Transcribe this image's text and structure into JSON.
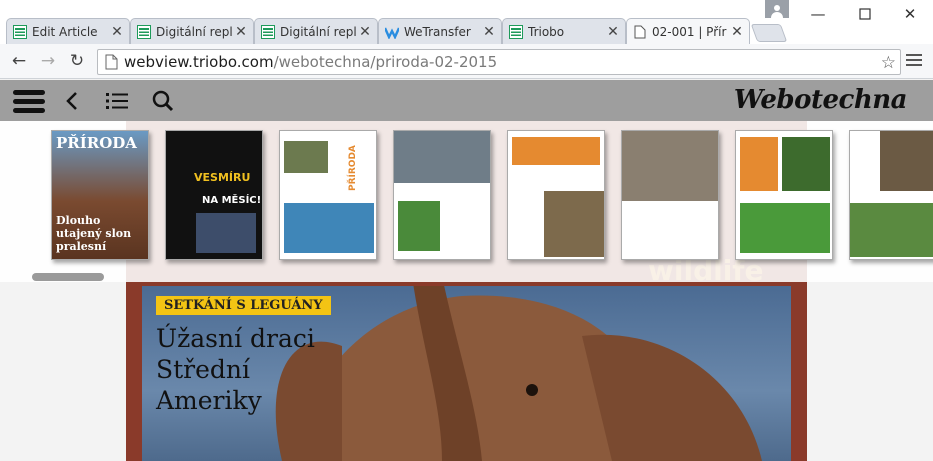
{
  "tabs": [
    {
      "title": "Edit Article",
      "icon": "sheet-icon",
      "active": false
    },
    {
      "title": "Digitální repl",
      "icon": "sheet-icon",
      "active": false
    },
    {
      "title": "Digitální repl",
      "icon": "sheet-icon",
      "active": false
    },
    {
      "title": "WeTransfer",
      "icon": "wetransfer-icon",
      "active": false
    },
    {
      "title": "Triobo",
      "icon": "sheet-icon",
      "active": false
    },
    {
      "title": "02-001 | Přír",
      "icon": "page-icon",
      "active": true
    }
  ],
  "address": {
    "host": "webview.triobo.com",
    "path": "/webotechna/priroda-02-2015"
  },
  "app": {
    "brand": "Webotechna"
  },
  "thumbnails": [
    {
      "label": "cover",
      "color": "#7a3d28",
      "title": "PŘÍRODA",
      "caption": "Dlouho utajený slon pralesní"
    },
    {
      "label": "vesmir",
      "color": "#101010",
      "title": "VESMÍRU",
      "caption": "NA MĚSÍC!"
    },
    {
      "label": "editorial",
      "color": "#ffffff",
      "title": "PŘÍRODA",
      "caption": ""
    },
    {
      "label": "contents-lizards",
      "color": "#6f7d88",
      "title": "",
      "caption": ""
    },
    {
      "label": "orange-ocelot",
      "color": "#e58a30",
      "title": "",
      "caption": ""
    },
    {
      "label": "lions",
      "color": "#8a7f70",
      "title": "",
      "caption": ""
    },
    {
      "label": "gorilla",
      "color": "#e58a30",
      "title": "",
      "caption": ""
    },
    {
      "label": "tortoise",
      "color": "#5a8a40",
      "title": "",
      "caption": ""
    }
  ],
  "article": {
    "kicker": "SETKÁNÍ S LEGUÁNY",
    "headline": "Úžasní draci\nStřední\nAmeriky",
    "watermark": "wildlife"
  }
}
